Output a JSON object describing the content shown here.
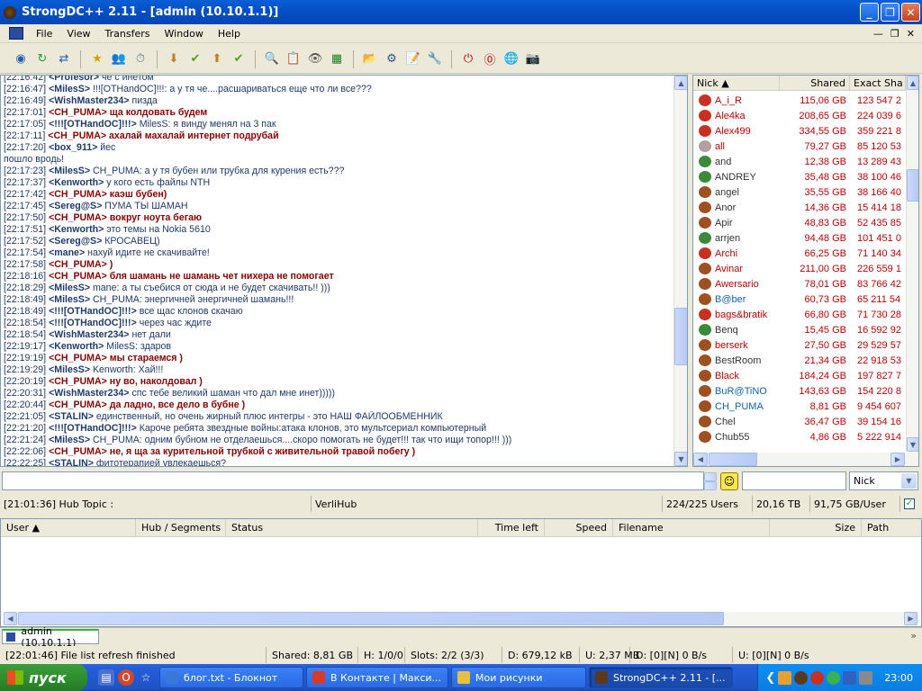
{
  "window": {
    "title": "StrongDC++ 2.11 - [admin (10.10.1.1)]"
  },
  "menu": [
    "File",
    "View",
    "Transfers",
    "Window",
    "Help"
  ],
  "toolbar_icons": [
    "connect-icon",
    "reconnect-icon",
    "follow-redirect-icon",
    "favorites-icon",
    "favorite-users-icon",
    "recent-hubs-icon",
    "download-queue-icon",
    "finished-downloads-icon",
    "upload-queue-icon",
    "finished-uploads-icon",
    "search-icon",
    "adl-search-icon",
    "search-spy-icon",
    "network-stats-icon",
    "open-file-list-icon",
    "settings-icon",
    "notepad-icon",
    "cdm-debug-icon",
    "shutdown-icon",
    "limiter-icon",
    "plugins-icon",
    "away-icon"
  ],
  "chat": [
    {
      "ts": "[22:16:42]",
      "nick": "<Profesor>",
      "text": "че с инетом",
      "hi": false
    },
    {
      "ts": "[22:16:47]",
      "nick": "<MilesS>",
      "text": "!!![OTHandOC]!!!: а у тя че....расшариваться еще что ли все???",
      "hi": false
    },
    {
      "ts": "[22:16:49]",
      "nick": "<WishMaster234>",
      "text": "пизда",
      "hi": false
    },
    {
      "ts": "[22:17:01]",
      "nick": "<CH_PUMA>",
      "text": "ща колдовать будем",
      "hi": true
    },
    {
      "ts": "[22:17:05]",
      "nick": "<!!![OTHandOC]!!!>",
      "text": "MilesS: я винду менял на 3 пак",
      "hi": false
    },
    {
      "ts": "[22:17:11]",
      "nick": "<CH_PUMA>",
      "text": "ахалай махалай интернет подрубай",
      "hi": true
    },
    {
      "ts": "[22:17:20]",
      "nick": "<box_911>",
      "text": "йес",
      "hi": false
    },
    {
      "ts": "",
      "nick": "",
      "text": "пошло вродь!",
      "hi": false
    },
    {
      "ts": "[22:17:23]",
      "nick": "<MilesS>",
      "text": "CH_PUMA: а у тя бубен или трубка для курения есть???",
      "hi": false
    },
    {
      "ts": "[22:17:37]",
      "nick": "<Kenworth>",
      "text": "у кого есть файлы NTH",
      "hi": false
    },
    {
      "ts": "[22:17:42]",
      "nick": "<CH_PUMA>",
      "text": "каэш бубен)",
      "hi": true
    },
    {
      "ts": "[22:17:45]",
      "nick": "<Sereg@S>",
      "text": "ПУМА ТЫ ШАМАН",
      "hi": false
    },
    {
      "ts": "[22:17:50]",
      "nick": "<CH_PUMA>",
      "text": "вокруг ноута бегаю",
      "hi": true
    },
    {
      "ts": "[22:17:51]",
      "nick": "<Kenworth>",
      "text": "это темы на Nokia 5610",
      "hi": false
    },
    {
      "ts": "[22:17:52]",
      "nick": "<Sereg@S>",
      "text": "КРОСАВЕЦ)",
      "hi": false
    },
    {
      "ts": "[22:17:54]",
      "nick": "<mane>",
      "text": "нахуй идите не скачивайте!",
      "hi": false
    },
    {
      "ts": "[22:17:58]",
      "nick": "<CH_PUMA>",
      "text": ")",
      "hi": true
    },
    {
      "ts": "[22:18:16]",
      "nick": "<CH_PUMA>",
      "text": "бля шамань не шамань чет нихера не помогает",
      "hi": true
    },
    {
      "ts": "[22:18:29]",
      "nick": "<MilesS>",
      "text": "mane: а ты съебися от сюда и не будет скачивать!! )))",
      "hi": false
    },
    {
      "ts": "[22:18:49]",
      "nick": "<MilesS>",
      "text": "CH_PUMA: энергичней энергичней шамань!!!",
      "hi": false
    },
    {
      "ts": "[22:18:49]",
      "nick": "<!!![OTHandOC]!!!>",
      "text": "все щас клонов скачаю",
      "hi": false
    },
    {
      "ts": "[22:18:54]",
      "nick": "<!!![OTHandOC]!!!>",
      "text": "через час ждите",
      "hi": false
    },
    {
      "ts": "[22:18:54]",
      "nick": "<WishMaster234>",
      "text": "нет дали",
      "hi": false
    },
    {
      "ts": "[22:19:17]",
      "nick": "<Kenworth>",
      "text": "MilesS: здаров",
      "hi": false
    },
    {
      "ts": "[22:19:19]",
      "nick": "<CH_PUMA>",
      "text": "мы стараемся )",
      "hi": true
    },
    {
      "ts": "[22:19:29]",
      "nick": "<MilesS>",
      "text": "Kenworth: Хай!!!",
      "hi": false
    },
    {
      "ts": "[22:20:19]",
      "nick": "<CH_PUMA>",
      "text": "ну во, наколдовал )",
      "hi": true
    },
    {
      "ts": "[22:20:31]",
      "nick": "<WishMaster234>",
      "text": "спс тебе великий шаман что дал мне инет)))))",
      "hi": false
    },
    {
      "ts": "[22:20:44]",
      "nick": "<CH_PUMA>",
      "text": "да ладно, все дело в бубне )",
      "hi": true
    },
    {
      "ts": "[22:21:05]",
      "nick": "<STALIN>",
      "text": "единственный, но очень жирный плюс интегры - это НАШ ФАЙЛООБМЕННИК",
      "hi": false
    },
    {
      "ts": "[22:21:20]",
      "nick": "<!!![OTHandOC]!!!>",
      "text": "Кароче ребята звездные войны:атака клонов, это мультсериал компьютерный",
      "hi": false
    },
    {
      "ts": "[22:21:24]",
      "nick": "<MilesS>",
      "text": "CH_PUMA: одним бубном не отделаешься....скоро помогать не будет!!! так что ищи топор!!! )))",
      "hi": false
    },
    {
      "ts": "[22:22:06]",
      "nick": "<CH_PUMA>",
      "text": "не, я ща за курительной трубкой с живительной травой побегу )",
      "hi": true
    },
    {
      "ts": "[22:22:25]",
      "nick": "<STALIN>",
      "text": "фитотерапией увлекаешься?",
      "hi": false
    }
  ],
  "userlist": {
    "columns": [
      "Nick",
      "Shared",
      "Exact Sha"
    ],
    "rows": [
      {
        "nick": "A_i_R",
        "shared": "115,06 GB",
        "exact": "123 547 2",
        "icon": "#c83020",
        "color": "#c00000"
      },
      {
        "nick": "Ale4ka",
        "shared": "208,65 GB",
        "exact": "224 039 6",
        "icon": "#c83020",
        "color": "#c00000"
      },
      {
        "nick": "Alex499",
        "shared": "334,55 GB",
        "exact": "359 221 8",
        "icon": "#c83020",
        "color": "#c00000"
      },
      {
        "nick": "all",
        "shared": "79,27 GB",
        "exact": "85 120 53",
        "icon": "#b0a0a0",
        "color": "#c00000"
      },
      {
        "nick": "and",
        "shared": "12,38 GB",
        "exact": "13 289 43",
        "icon": "#3a8a3a",
        "color": "#333333"
      },
      {
        "nick": "ANDREY",
        "shared": "35,48 GB",
        "exact": "38 100 46",
        "icon": "#3a8a3a",
        "color": "#333333"
      },
      {
        "nick": "angel",
        "shared": "35,55 GB",
        "exact": "38 166 40",
        "icon": "#a05020",
        "color": "#333333"
      },
      {
        "nick": "Anor",
        "shared": "14,36 GB",
        "exact": "15 414 18",
        "icon": "#a05020",
        "color": "#333333"
      },
      {
        "nick": "Apir",
        "shared": "48,83 GB",
        "exact": "52 435 85",
        "icon": "#a05020",
        "color": "#333333"
      },
      {
        "nick": "arrjen",
        "shared": "94,48 GB",
        "exact": "101 451 0",
        "icon": "#3a8a3a",
        "color": "#333333"
      },
      {
        "nick": "Archi",
        "shared": "66,25 GB",
        "exact": "71 140 34",
        "icon": "#c83020",
        "color": "#c00000"
      },
      {
        "nick": "Avinar",
        "shared": "211,00 GB",
        "exact": "226 559 1",
        "icon": "#a05020",
        "color": "#c00000"
      },
      {
        "nick": "Awersario",
        "shared": "78,01 GB",
        "exact": "83 766 42",
        "icon": "#a05020",
        "color": "#c00000"
      },
      {
        "nick": "B@ber",
        "shared": "60,73 GB",
        "exact": "65 211 54",
        "icon": "#a05020",
        "color": "#1060b0"
      },
      {
        "nick": "bags&bratik",
        "shared": "66,80 GB",
        "exact": "71 730 28",
        "icon": "#c83020",
        "color": "#c00000"
      },
      {
        "nick": "Benq",
        "shared": "15,45 GB",
        "exact": "16 592 92",
        "icon": "#3a8a3a",
        "color": "#333333"
      },
      {
        "nick": "berserk",
        "shared": "27,50 GB",
        "exact": "29 529 57",
        "icon": "#a05020",
        "color": "#c00000"
      },
      {
        "nick": "BestRoom",
        "shared": "21,34 GB",
        "exact": "22 918 53",
        "icon": "#a05020",
        "color": "#333333"
      },
      {
        "nick": "Black",
        "shared": "184,24 GB",
        "exact": "197 827 7",
        "icon": "#a05020",
        "color": "#c00000"
      },
      {
        "nick": "BuR@TiNO",
        "shared": "143,63 GB",
        "exact": "154 220 8",
        "icon": "#a05020",
        "color": "#1060b0"
      },
      {
        "nick": "CH_PUMA",
        "shared": "8,81 GB",
        "exact": "9 454 607",
        "icon": "#a05020",
        "color": "#1060b0"
      },
      {
        "nick": "Chel",
        "shared": "36,47 GB",
        "exact": "39 154 16",
        "icon": "#a05020",
        "color": "#333333"
      },
      {
        "nick": "Chub55",
        "shared": "4,86 GB",
        "exact": "5 222 914",
        "icon": "#a05020",
        "color": "#333333"
      }
    ]
  },
  "msgbar": {
    "nick_select": "Nick"
  },
  "hub_status": {
    "topic": "[21:01:36] Hub Topic :",
    "hub_name": "VerliHub",
    "users": "224/225 Users",
    "shared": "20,16 TB",
    "per_user": "91,75 GB/User"
  },
  "transfers": {
    "columns": [
      "User",
      "Hub / Segments",
      "Status",
      "Time left",
      "Speed",
      "Filename",
      "Size",
      "Path"
    ]
  },
  "tabs": {
    "hub_tab": "admin (10.10.1.1)"
  },
  "status": {
    "message": "[22:01:46] File list refresh finished",
    "shared": "Shared: 8,81 GB",
    "hubs": "H: 1/0/0",
    "slots": "Slots: 2/2 (3/3)",
    "down": "D: 679,12 kB",
    "up": "U: 2,37 MB",
    "down_rate": "D: [0][N] 0 B/s",
    "up_rate": "U: [0][N] 0 B/s"
  },
  "taskbar": {
    "start": "пуск",
    "tasks": [
      {
        "label": "блог.txt - Блокнот",
        "icon": "#3a78d8",
        "active": false
      },
      {
        "label": "В Контакте | Макси...",
        "icon": "#d83a2a",
        "active": false
      },
      {
        "label": "Мои рисунки",
        "icon": "#e8c040",
        "active": false
      },
      {
        "label": "StrongDC++ 2.11 - [...",
        "icon": "#5a3a1a",
        "active": true
      }
    ],
    "clock": "23:00"
  }
}
